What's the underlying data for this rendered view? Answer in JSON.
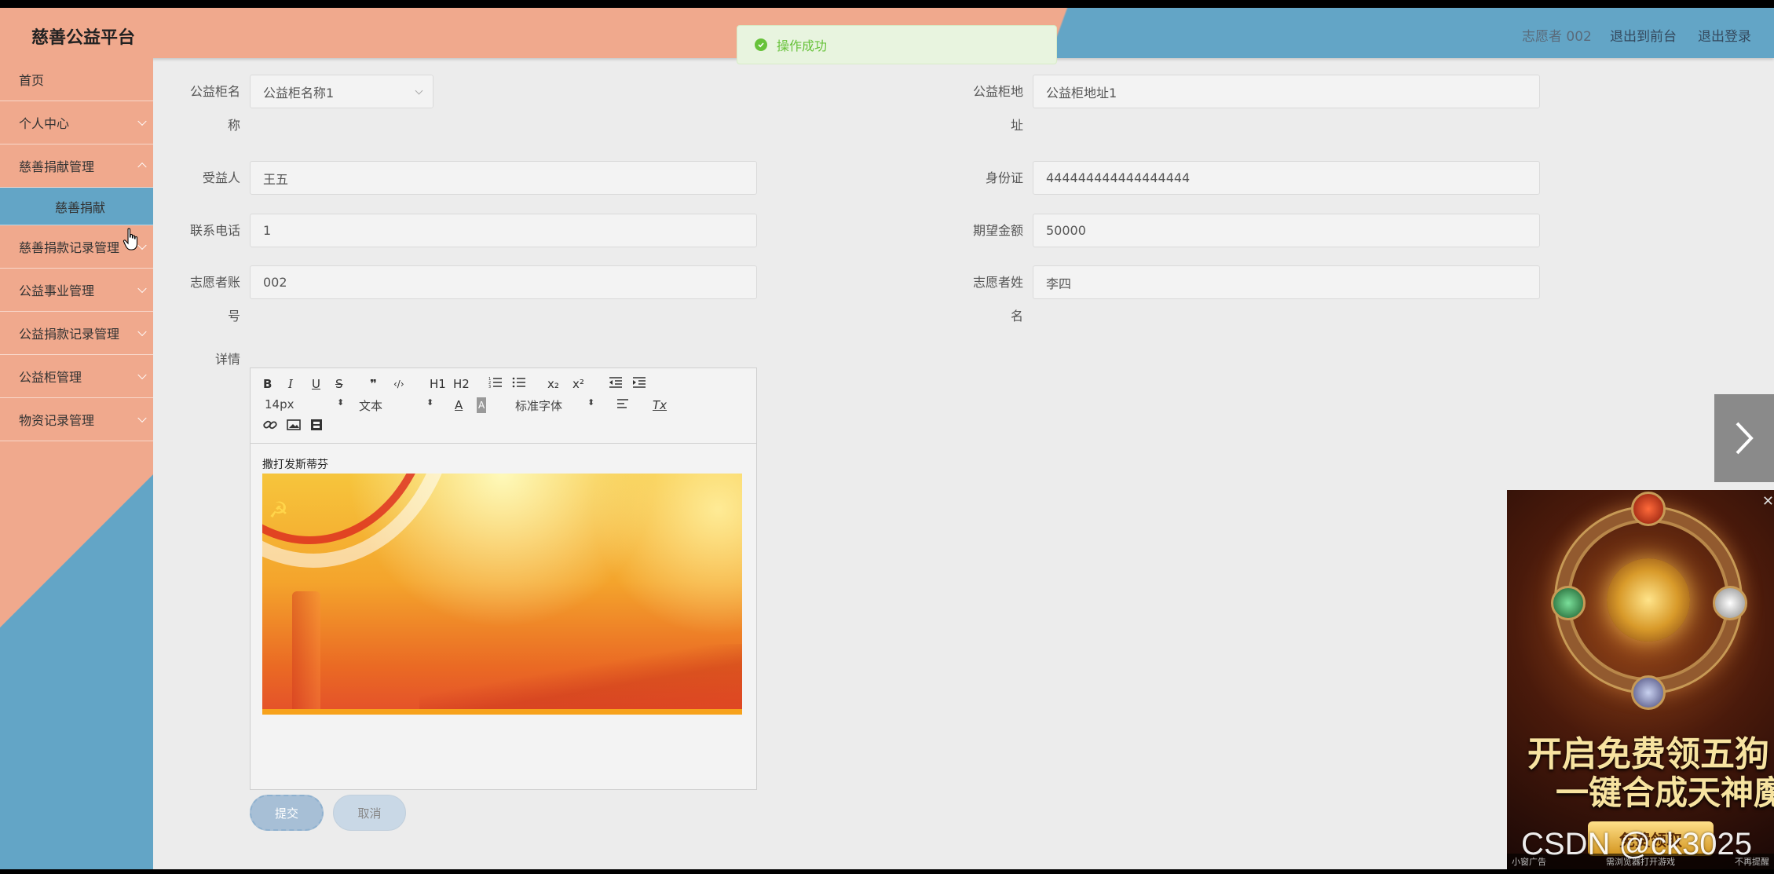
{
  "header": {
    "brand": "慈善公益平台",
    "user": "志愿者 002",
    "to_front": "退出到前台",
    "logout": "退出登录"
  },
  "toast": {
    "message": "操作成功"
  },
  "sidebar": {
    "items": [
      {
        "label": "首页"
      },
      {
        "label": "个人中心"
      },
      {
        "label": "慈善捐献管理"
      },
      {
        "label": "慈善捐献"
      },
      {
        "label": "慈善捐款记录管理"
      },
      {
        "label": "公益事业管理"
      },
      {
        "label": "公益捐款记录管理"
      },
      {
        "label": "公益柜管理"
      },
      {
        "label": "物资记录管理"
      }
    ]
  },
  "form": {
    "cabinet_name": {
      "label_1": "公益柜名",
      "label_2": "称",
      "value": "公益柜名称1"
    },
    "cabinet_address": {
      "label_1": "公益柜地",
      "label_2": "址",
      "value": "公益柜地址1"
    },
    "beneficiary": {
      "label": "受益人",
      "value": "王五"
    },
    "id_card": {
      "label": "身份证",
      "value": "444444444444444444"
    },
    "phone": {
      "label": "联系电话",
      "value": "1"
    },
    "expected_amount": {
      "label": "期望金额",
      "value": "50000"
    },
    "volunteer_account": {
      "label_1": "志愿者账",
      "label_2": "号",
      "value": "002"
    },
    "volunteer_name": {
      "label_1": "志愿者姓",
      "label_2": "名",
      "value": "李四"
    },
    "details": {
      "label": "详情"
    }
  },
  "editor": {
    "toolbar": {
      "bold": "B",
      "italic": "I",
      "underline": "U",
      "strike": "S",
      "quote": "❞",
      "code": "‹/›",
      "h1": "H1",
      "h2": "H2",
      "subscript": "x₂",
      "superscript": "x²",
      "font_size": "14px",
      "text_type": "文本",
      "font_family": "标准字体",
      "clear": "Tx"
    },
    "content_text": "撒打发斯蒂芬"
  },
  "buttons": {
    "submit": "提交",
    "cancel": "取消"
  },
  "ad": {
    "title_line1": "开启免费领五狗",
    "title_line2": "一键合成天神魔",
    "claim": "免费领取",
    "footer_left": "小窗广告",
    "footer_mid": "需浏览器打开游戏",
    "footer_right": "不再提醒"
  },
  "watermark": "CSDN @ck3025",
  "colors": {
    "salmon": "#f0a98d",
    "steel_blue": "#63a5c6",
    "success_green": "#67c23a"
  }
}
